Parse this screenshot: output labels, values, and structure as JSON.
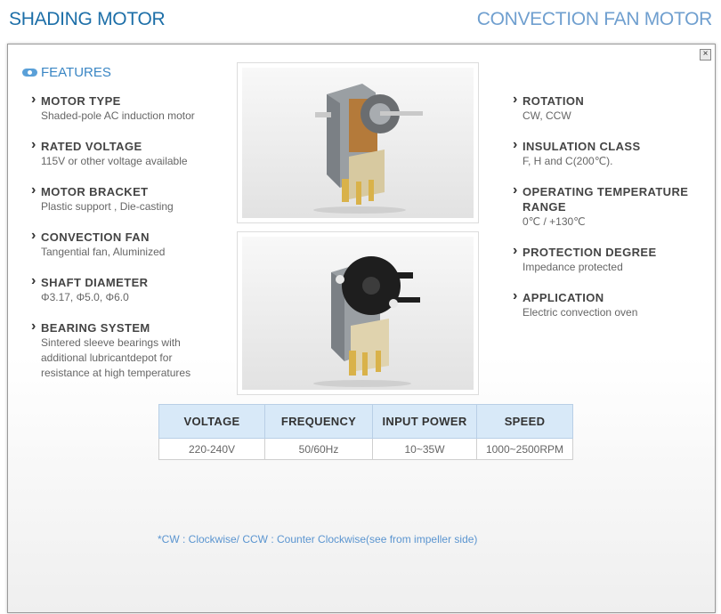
{
  "header": {
    "left_title": "SHADING MOTOR",
    "right_title": "CONVECTION FAN MOTOR"
  },
  "popup": {
    "close_label": "×",
    "features_title": "FEATURES",
    "left_specs": [
      {
        "label": "MOTOR TYPE",
        "value": "Shaded-pole AC induction motor"
      },
      {
        "label": "RATED VOLTAGE",
        "value": "115V or other voltage available"
      },
      {
        "label": "MOTOR BRACKET",
        "value": "Plastic support , Die-casting"
      },
      {
        "label": "CONVECTION FAN",
        "value": "Tangential fan, Aluminized"
      },
      {
        "label": "SHAFT DIAMETER",
        "value": "Φ3.17, Φ5.0, Φ6.0"
      },
      {
        "label": "BEARING SYSTEM",
        "value": "Sintered sleeve bearings with additional lubricantdepot for resistance at high temperatures"
      }
    ],
    "right_specs": [
      {
        "label": "ROTATION",
        "value": "CW, CCW"
      },
      {
        "label": "INSULATION CLASS",
        "value": "F, H and C(200℃)."
      },
      {
        "label": "OPERATING TEMPERATURE RANGE",
        "value": "0℃ / +130℃"
      },
      {
        "label": "PROTECTION DEGREE",
        "value": "Impedance protected"
      },
      {
        "label": "APPLICATION",
        "value": "Electric convection oven"
      }
    ],
    "table": {
      "headers": [
        "VOLTAGE",
        "FREQUENCY",
        "INPUT POWER",
        "SPEED"
      ],
      "row": [
        "220-240V",
        "50/60Hz",
        "10~35W",
        "1000~2500RPM"
      ]
    },
    "note": "*CW : Clockwise/ CCW : Counter Clockwise(see from impeller side)"
  },
  "icons": [
    "close-icon",
    "features-bullet-icon",
    "chevron-right-icon"
  ],
  "colors": {
    "accent": "#3a86c4",
    "header_left": "#1d6fa8",
    "header_right": "#6f9fcf",
    "table_header": "#d8e9f8",
    "note": "#5b95d0"
  }
}
